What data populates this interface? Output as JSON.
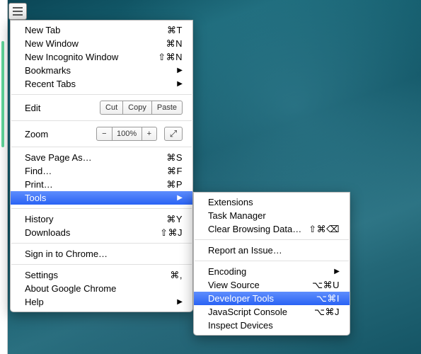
{
  "hamburger": "Menu",
  "main": {
    "newTab": {
      "label": "New Tab",
      "sc": "⌘T"
    },
    "newWindow": {
      "label": "New Window",
      "sc": "⌘N"
    },
    "newIncognito": {
      "label": "New Incognito Window",
      "sc": "⇧⌘N"
    },
    "bookmarks": {
      "label": "Bookmarks"
    },
    "recentTabs": {
      "label": "Recent Tabs"
    },
    "edit": {
      "label": "Edit",
      "cut": "Cut",
      "copy": "Copy",
      "paste": "Paste"
    },
    "zoom": {
      "label": "Zoom",
      "minus": "−",
      "value": "100%",
      "plus": "+"
    },
    "savePage": {
      "label": "Save Page As…",
      "sc": "⌘S"
    },
    "find": {
      "label": "Find…",
      "sc": "⌘F"
    },
    "print": {
      "label": "Print…",
      "sc": "⌘P"
    },
    "tools": {
      "label": "Tools"
    },
    "history": {
      "label": "History",
      "sc": "⌘Y"
    },
    "downloads": {
      "label": "Downloads",
      "sc": "⇧⌘J"
    },
    "signIn": {
      "label": "Sign in to Chrome…"
    },
    "settings": {
      "label": "Settings",
      "sc": "⌘,"
    },
    "about": {
      "label": "About Google Chrome"
    },
    "help": {
      "label": "Help"
    }
  },
  "sub": {
    "extensions": {
      "label": "Extensions"
    },
    "taskManager": {
      "label": "Task Manager"
    },
    "clearBrowsing": {
      "label": "Clear Browsing Data…",
      "sc": "⇧⌘⌫"
    },
    "reportIssue": {
      "label": "Report an Issue…"
    },
    "encoding": {
      "label": "Encoding"
    },
    "viewSource": {
      "label": "View Source",
      "sc": "⌥⌘U"
    },
    "devTools": {
      "label": "Developer Tools",
      "sc": "⌥⌘I"
    },
    "jsConsole": {
      "label": "JavaScript Console",
      "sc": "⌥⌘J"
    },
    "inspectDev": {
      "label": "Inspect Devices"
    }
  }
}
